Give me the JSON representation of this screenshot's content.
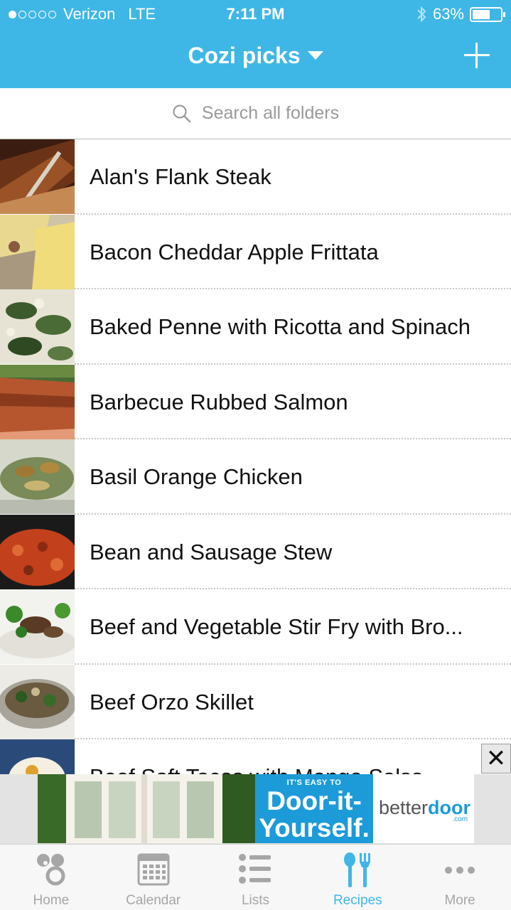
{
  "status_bar": {
    "carrier": "Verizon",
    "network": "LTE",
    "time": "7:11 PM",
    "battery_percent": "63%",
    "battery_level": 0.63,
    "signal_bars_filled": 1,
    "signal_bars_total": 5
  },
  "nav": {
    "title": "Cozi picks",
    "add_icon": "plus-icon",
    "title_icon": "caret-down-icon"
  },
  "search": {
    "placeholder": "Search all folders",
    "icon": "search-icon"
  },
  "recipes": [
    {
      "name": "Alan's Flank Steak"
    },
    {
      "name": "Bacon Cheddar Apple Frittata"
    },
    {
      "name": "Baked Penne with Ricotta and Spinach"
    },
    {
      "name": "Barbecue Rubbed Salmon"
    },
    {
      "name": "Basil Orange Chicken"
    },
    {
      "name": "Bean and Sausage Stew"
    },
    {
      "name": "Beef and Vegetable Stir Fry with Bro..."
    },
    {
      "name": "Beef Orzo Skillet"
    },
    {
      "name": "Beef Soft Tacos with Mango Salsa"
    }
  ],
  "ad": {
    "tagline": "IT'S EASY TO",
    "headline_line1": "Door-it-",
    "headline_line2": "Yourself.",
    "brand_prefix": "better",
    "brand_suffix": "door",
    "brand_domain": ".com",
    "close_label": "✕",
    "dismiss_label": "✕"
  },
  "tabs": [
    {
      "label": "Home",
      "icon": "home-icon",
      "active": false
    },
    {
      "label": "Calendar",
      "icon": "calendar-icon",
      "active": false
    },
    {
      "label": "Lists",
      "icon": "lists-icon",
      "active": false
    },
    {
      "label": "Recipes",
      "icon": "recipes-icon",
      "active": true
    },
    {
      "label": "More",
      "icon": "more-icon",
      "active": false
    }
  ],
  "colors": {
    "accent": "#3fb7e6",
    "tab_inactive": "#a6a6a6",
    "ad_blue": "#1d9bd8"
  }
}
